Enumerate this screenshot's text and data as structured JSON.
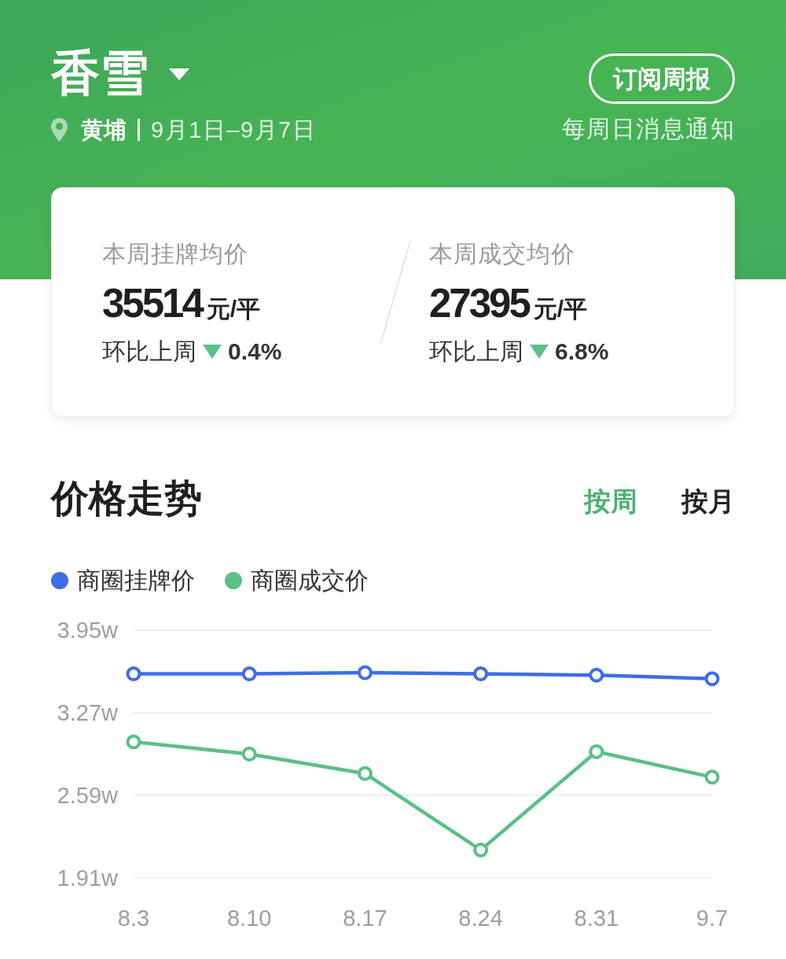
{
  "header": {
    "title": "香雪",
    "district": "黄埔",
    "date_range": "9月1日–9月7日",
    "subscribe_button": "订阅周报",
    "subscribe_note": "每周日消息通知"
  },
  "summary": [
    {
      "label": "本周挂牌均价",
      "price": "35514",
      "unit": "元/平",
      "change_label": "环比上周",
      "down": true,
      "change": "0.4%"
    },
    {
      "label": "本周成交均价",
      "price": "27395",
      "unit": "元/平",
      "change_label": "环比上周",
      "down": true,
      "change": "6.8%"
    }
  ],
  "trend": {
    "title": "价格走势",
    "tabs": [
      {
        "label": "按周",
        "selected": true
      },
      {
        "label": "按月",
        "selected": false
      }
    ],
    "chart_data": {
      "type": "line",
      "categories": [
        "8.3",
        "8.10",
        "8.17",
        "8.24",
        "8.31",
        "9.7"
      ],
      "series": [
        {
          "name": "商圈挂牌价",
          "color": "#3d6ee6",
          "marker": "circle",
          "values": [
            3.59,
            3.59,
            3.6,
            3.59,
            3.58,
            3.55
          ]
        },
        {
          "name": "商圈成交价",
          "color": "#5bbf87",
          "marker": "circle",
          "values": [
            3.03,
            2.93,
            2.77,
            2.14,
            2.95,
            2.74
          ]
        }
      ],
      "ylim": [
        1.91,
        3.95
      ],
      "yticks": [
        {
          "value": 3.95,
          "label": "3.95w"
        },
        {
          "value": 3.27,
          "label": "3.27w"
        },
        {
          "value": 2.59,
          "label": "2.59w"
        },
        {
          "value": 1.91,
          "label": "1.91w"
        }
      ]
    }
  }
}
